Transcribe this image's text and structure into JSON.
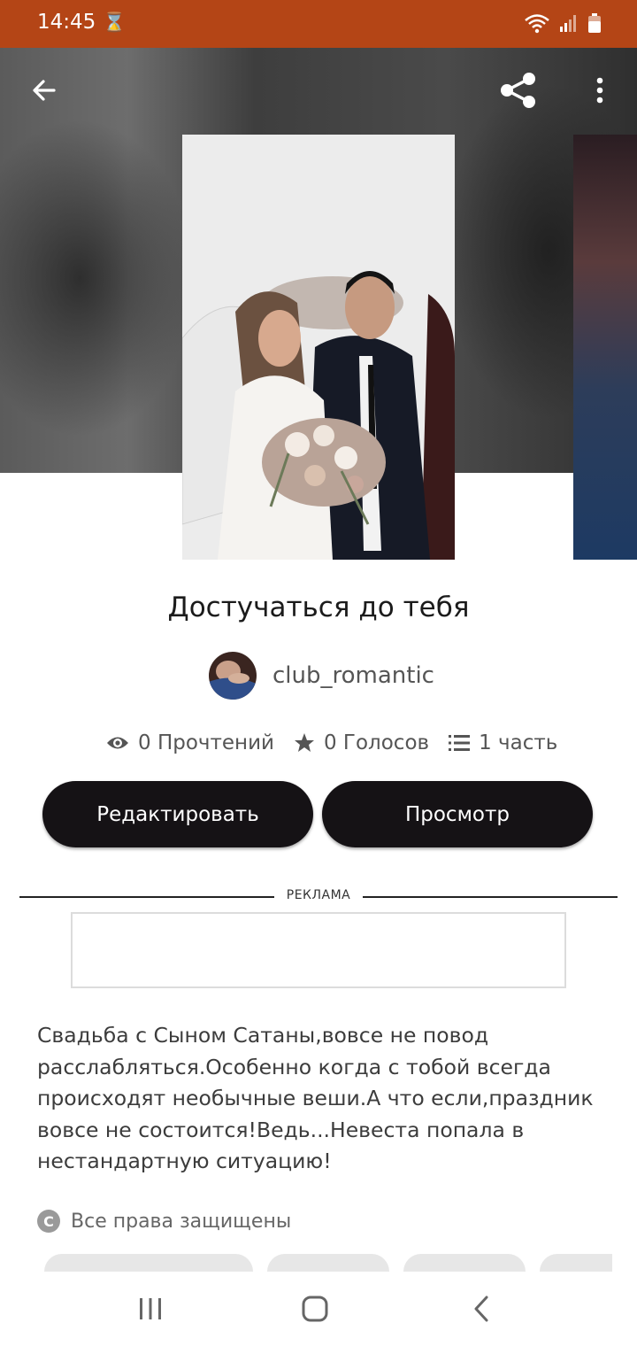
{
  "status_bar": {
    "time": "14:45",
    "hourglass_icon": "hourglass-icon",
    "wifi_icon": "wifi-icon",
    "signal_icon": "signal-icon",
    "battery_icon": "battery-icon",
    "background": "#b44516"
  },
  "toolbar": {
    "back_icon": "arrow-left-icon",
    "share_icon": "share-icon",
    "more_icon": "more-vertical-icon"
  },
  "book": {
    "title": "Достучаться до тебя",
    "author": "club_romantic",
    "stats": {
      "reads_icon": "eye-icon",
      "reads": "0 Прочтений",
      "votes_icon": "star-icon",
      "votes": "0 Голосов",
      "parts_icon": "list-icon",
      "parts": "1 часть"
    },
    "edit_label": "Редактировать",
    "view_label": "Просмотр",
    "description": "Свадьба с Сыном Сатаны,вовсе не повод расслабляться.Особенно когда с тобой всегда происходят необычные веши.А что если,праздник вовсе не состоится!Ведь...Невеста попала в нестандартную ситуацию!",
    "copyright": "Все права защищены"
  },
  "ad": {
    "label": "РЕКЛАМА"
  },
  "nav_bar": {
    "recents_icon": "recents-icon",
    "home_icon": "home-icon",
    "back_icon": "back-chevron-icon"
  },
  "colors": {
    "accent": "#b44516",
    "button": "#151215"
  }
}
